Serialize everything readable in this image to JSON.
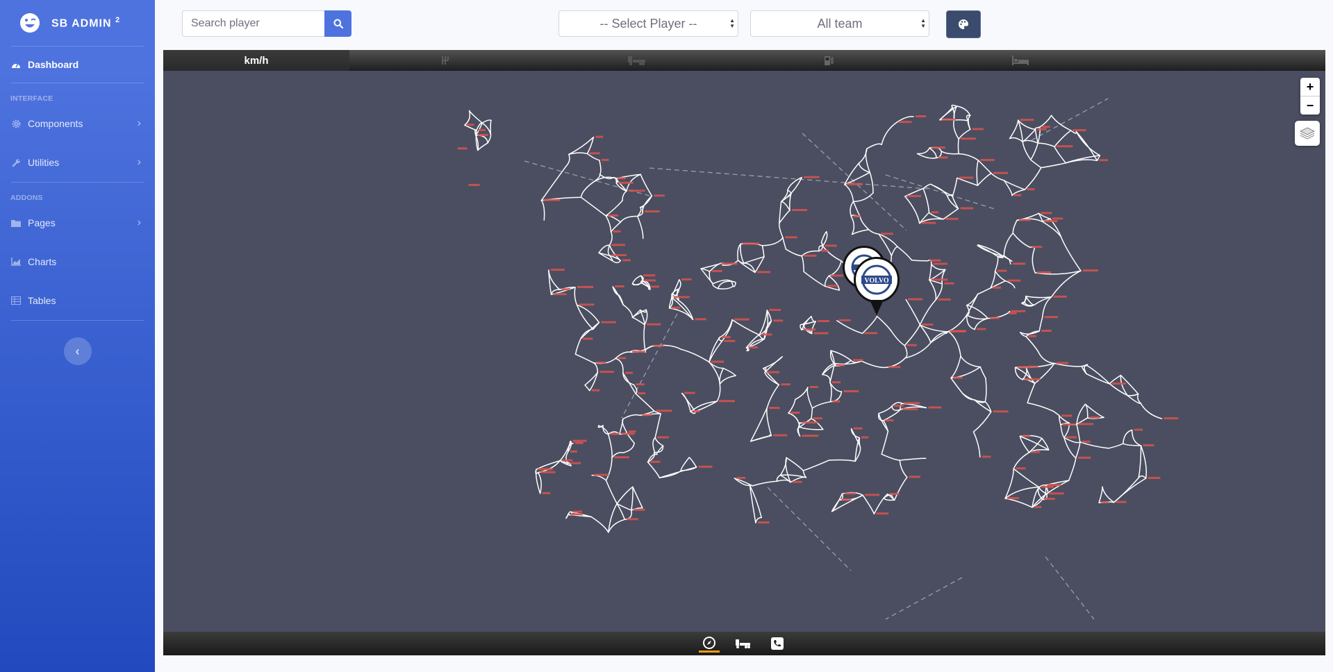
{
  "sidebar": {
    "brand": "SB ADMIN",
    "brand_sup": "2",
    "dashboard": "Dashboard",
    "heading_interface": "INTERFACE",
    "components": "Components",
    "utilities": "Utilities",
    "heading_addons": "ADDONS",
    "pages": "Pages",
    "charts": "Charts",
    "tables": "Tables"
  },
  "topbar": {
    "search_placeholder": "Search player",
    "player_select": "-- Select Player --",
    "team_select": "All team"
  },
  "dashboard": {
    "speed_unit": "km/h",
    "top_icons": [
      "gear-shift-icon",
      "truck-icon",
      "fuel-icon",
      "bed-icon"
    ],
    "bottom_icons": [
      "compass-icon",
      "truck-icon",
      "phone-icon"
    ],
    "active_bottom": "compass-icon"
  },
  "map": {
    "zoom_in": "+",
    "zoom_out": "−",
    "marker_brand": "VOLVO",
    "background_color": "#4a4e60",
    "road_color": "#ffffff",
    "city_label_color": "#d9534f"
  },
  "colors": {
    "sidebar_top": "#4e73df",
    "sidebar_bottom": "#224abe",
    "accent": "#4e73df",
    "active_tab": "#f39c12"
  }
}
